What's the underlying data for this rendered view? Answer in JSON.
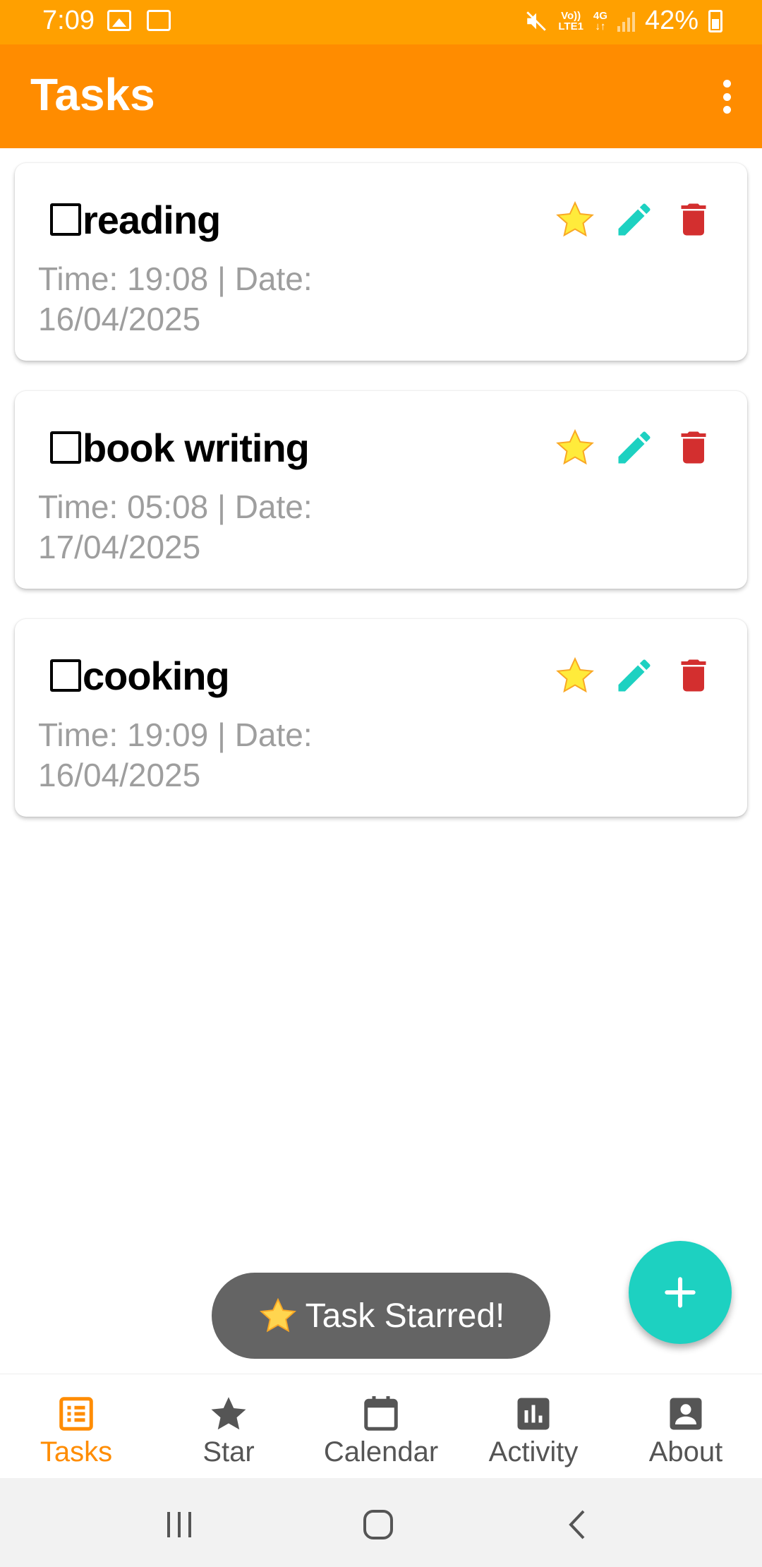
{
  "status_bar": {
    "time": "7:09",
    "volte_line1": "Vo))",
    "volte_line2": "LTE1",
    "network": "4G",
    "battery": "42%"
  },
  "app_bar": {
    "title": "Tasks"
  },
  "tasks": [
    {
      "checkbox": "☐",
      "title": "reading",
      "meta": "Time: 19:08 | Date: 16/04/2025"
    },
    {
      "checkbox": "☐",
      "title": "book writing",
      "meta": "Time: 05:08 | Date: 17/04/2025"
    },
    {
      "checkbox": "☐",
      "title": "cooking",
      "meta": "Time: 19:09 | Date: 16/04/2025"
    }
  ],
  "toast": {
    "icon": "star-icon",
    "text": "Task Starred!"
  },
  "bottom_nav": [
    {
      "label": "Tasks",
      "icon": "list-icon",
      "active": true
    },
    {
      "label": "Star",
      "icon": "star-icon",
      "active": false
    },
    {
      "label": "Calendar",
      "icon": "calendar-icon",
      "active": false
    },
    {
      "label": "Activity",
      "icon": "bar-chart-icon",
      "active": false
    },
    {
      "label": "About",
      "icon": "account-box-icon",
      "active": false
    }
  ],
  "colors": {
    "status_bar": "#FFA000",
    "app_bar": "#FF8C00",
    "star": "#FFEB3B",
    "edit": "#1DD1C1",
    "delete": "#D32F2F",
    "fab": "#1DD1C1",
    "nav_active": "#FF8C00"
  }
}
